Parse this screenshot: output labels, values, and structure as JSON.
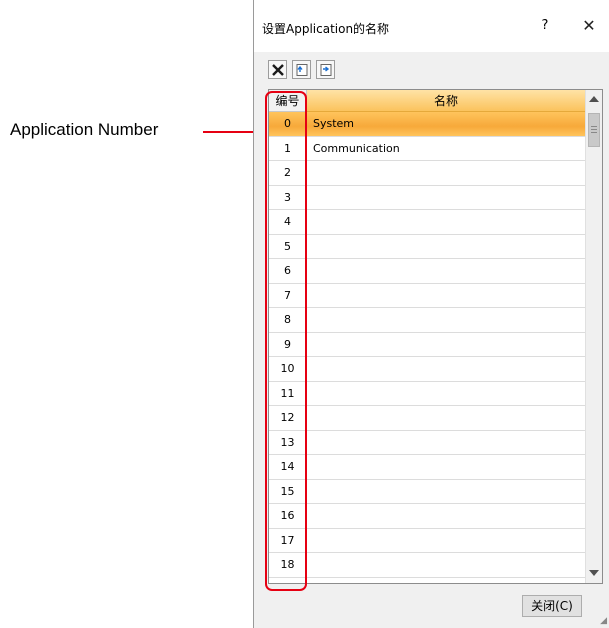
{
  "callout": {
    "text": "Application Number"
  },
  "dialog": {
    "title": "设置Application的名称",
    "help": "?",
    "close": "✕",
    "close_button_label": "关闭(C)"
  },
  "toolbar": {
    "icons": [
      "delete-icon",
      "import-icon",
      "export-icon"
    ]
  },
  "grid": {
    "headers": [
      "编号",
      "名称"
    ],
    "rows": [
      {
        "num": "0",
        "name": "System"
      },
      {
        "num": "1",
        "name": "Communication"
      },
      {
        "num": "2",
        "name": ""
      },
      {
        "num": "3",
        "name": ""
      },
      {
        "num": "4",
        "name": ""
      },
      {
        "num": "5",
        "name": ""
      },
      {
        "num": "6",
        "name": ""
      },
      {
        "num": "7",
        "name": ""
      },
      {
        "num": "8",
        "name": ""
      },
      {
        "num": "9",
        "name": ""
      },
      {
        "num": "10",
        "name": ""
      },
      {
        "num": "11",
        "name": ""
      },
      {
        "num": "12",
        "name": ""
      },
      {
        "num": "13",
        "name": ""
      },
      {
        "num": "14",
        "name": ""
      },
      {
        "num": "15",
        "name": ""
      },
      {
        "num": "16",
        "name": ""
      },
      {
        "num": "17",
        "name": ""
      },
      {
        "num": "18",
        "name": ""
      }
    ],
    "selected_row": 0
  },
  "colors": {
    "highlight": "#e60012",
    "selection": "#f7a93a"
  }
}
